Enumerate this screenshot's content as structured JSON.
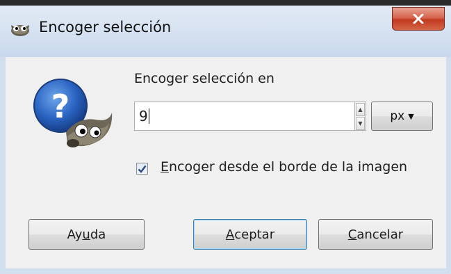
{
  "window": {
    "title": "Encoger selección",
    "close_glyph": "X"
  },
  "dialog": {
    "icon": "gimp-question-icon",
    "prompt": "Encoger selección en",
    "amount_value": "9",
    "unit": "px",
    "border_checkbox": {
      "checked": true,
      "label_accel": "E",
      "label_rest": "ncoger desde el borde de la imagen"
    }
  },
  "buttons": {
    "help": {
      "pre": "Ay",
      "accel": "u",
      "post": "da"
    },
    "ok": {
      "pre": "",
      "accel": "A",
      "post": "ceptar"
    },
    "cancel": {
      "pre": "",
      "accel": "C",
      "post": "ancelar"
    }
  },
  "colors": {
    "close_red": "#c2391f",
    "titlebar": "#d6e2f1",
    "client_bg": "#f0f0f0",
    "default_button_border": "#3c7fb1"
  }
}
